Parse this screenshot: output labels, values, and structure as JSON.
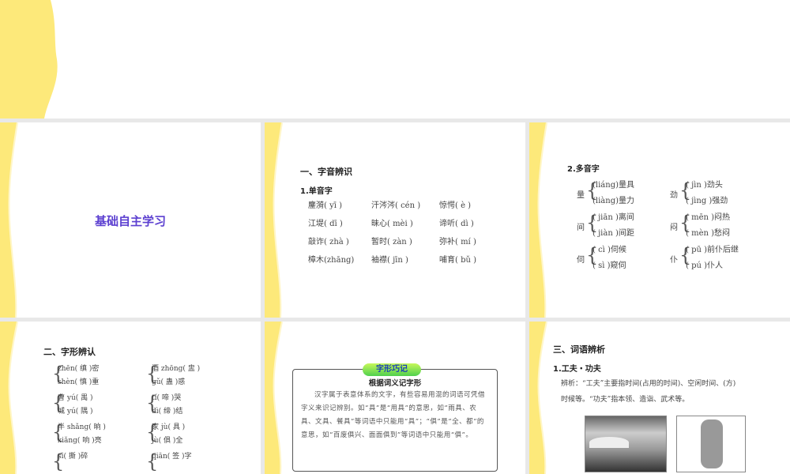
{
  "slides": {
    "s1": {
      "title": "基础自主学习"
    },
    "s2": {
      "heading": "一、字音辨识",
      "sub": "1.单音字",
      "items": [
        "鏖漪( yī )",
        "汗涔涔( cén )",
        "惊愕( è )",
        "江堤( dī )",
        "昧心( mèi )",
        "谛听( dì )",
        "敲诈( zhà )",
        "暂时( zàn )",
        "弥补( mí )",
        "樟木(zhāng)",
        "袖襟( jīn )",
        "哺育( bǔ )"
      ]
    },
    "s3": {
      "sub": "2.多音字",
      "groups": [
        {
          "char": "量",
          "a": "(liáng)量具",
          "b": "(liàng)量力"
        },
        {
          "char": "劲",
          "a": "( jìn )劲头",
          "b": "( jìng )强劲"
        },
        {
          "char": "间",
          "a": "( jiān )离间",
          "b": "( jiàn )间距"
        },
        {
          "char": "闷",
          "a": "( mēn )闷热",
          "b": "( mèn )愁闷"
        },
        {
          "char": "伺",
          "a": "( cì )伺候",
          "b": "( sì )窥伺"
        },
        {
          "char": "仆",
          "a": "( pū )前仆后继",
          "b": "( pú )仆人"
        }
      ]
    },
    "s4": {
      "heading": "二、字形辨认",
      "groups": [
        {
          "a": "zhēn( 缜 )密",
          "b": "shèn( 慎 )重"
        },
        {
          "a": "酒 zhōng( 盅 )",
          "b": "gǔ( 蛊 )惑"
        },
        {
          "a": "曹 yú( 禺 )",
          "b": "城 yú( 隅 )"
        },
        {
          "a": "tí( 啼 )哭",
          "b": "dì( 缔 )结"
        },
        {
          "a": "半 shǎng( 晌 )",
          "b": "xiǎng( 响 )亮"
        },
        {
          "a": "家 jù( 具 )",
          "b": "jù( 俱 )全"
        },
        {
          "a": "sī( 撕 )碎",
          "b": ""
        },
        {
          "a": "qiān( 签 )字",
          "b": ""
        }
      ]
    },
    "s5": {
      "badge": "字形巧记",
      "title": "根据词义记字形",
      "body": "汉字属于表意体系的文字，有些容易用混的词语可凭借字义来识记辨别。如“具”是“用具”的意思，如“雨具、农具、文具、餐具”等词语中只能用“具”；“俱”是“全、都”的意思，如“百废俱兴、面面俱到”等词语中只能用“俱”。"
    },
    "s6": {
      "heading": "三、词语辨析",
      "sub": "1.工夫・功夫",
      "line1": "辨析：“工夫”主要指时间(占用的时间)、空闲时间、(方)",
      "line2": "时候等。“功夫”指本领、造诣、武术等。"
    }
  },
  "colors": {
    "wave": "#fde97a",
    "title": "#5b3fd0"
  }
}
